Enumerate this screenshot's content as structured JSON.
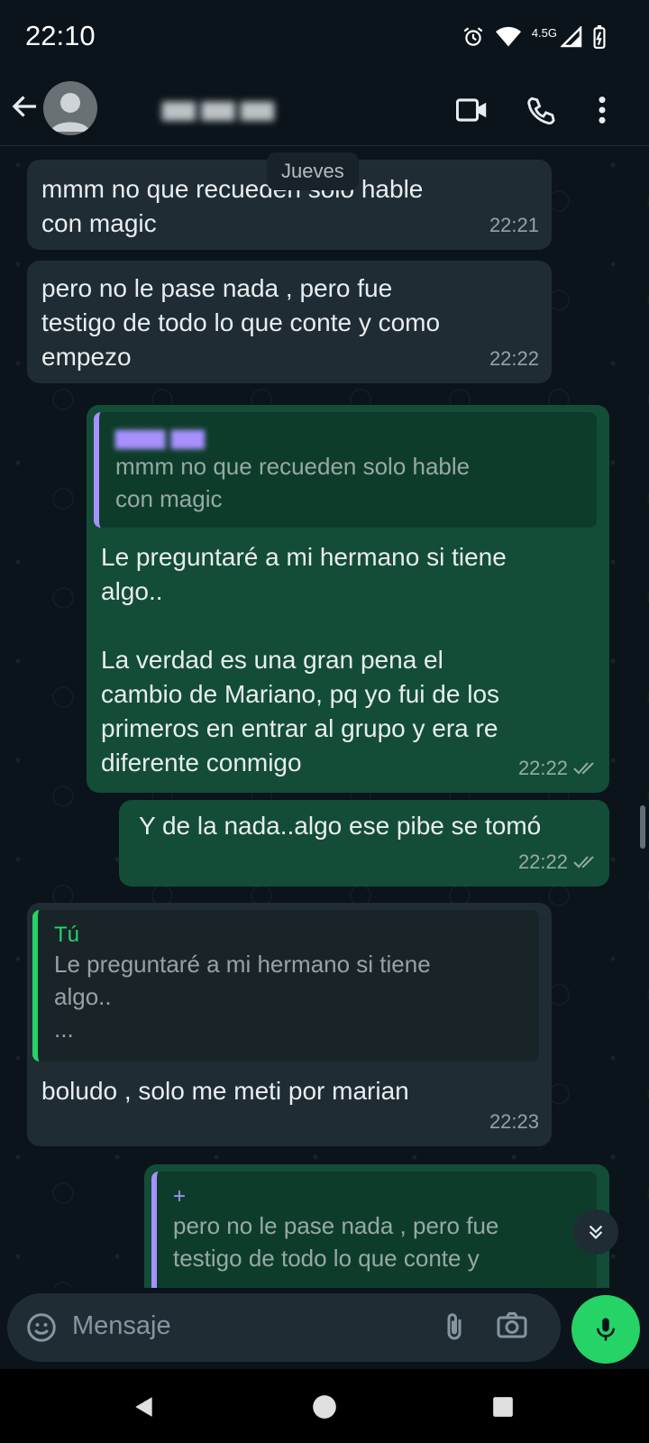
{
  "status": {
    "time": "22:10",
    "network": "4.5G"
  },
  "header": {
    "contact_name": "▆▆ ▆▆ ▆▆"
  },
  "chat": {
    "date_chip": "Jueves",
    "messages": [
      {
        "text": "mmm no que recueden solo hable\ncon magic",
        "time": "22:21"
      },
      {
        "text": "pero no le pase nada , pero fue\ntestigo de todo lo que conte y como\nempezo",
        "time": "22:22"
      },
      {
        "quote_author": "▆▆▆ ▆▆",
        "quote_text": "mmm no que recueden solo hable\ncon magic",
        "text": "Le preguntaré a mi hermano si tiene\nalgo..\n\nLa verdad es una gran pena el\ncambio de Mariano, pq yo fui de los\nprimeros en entrar al grupo y era re\ndiferente conmigo",
        "time": "22:22"
      },
      {
        "text": "Y de la nada..algo ese pibe se tomó",
        "time": "22:22"
      },
      {
        "quote_author": "Tú",
        "quote_text": "Le preguntaré a mi hermano si tiene\nalgo..\n...",
        "text": "boludo , solo me meti por marian",
        "time": "22:23"
      },
      {
        "quote_author": "+",
        "quote_text": "pero no le pase nada , pero fue\ntestigo de todo lo que conte y"
      }
    ]
  },
  "composer": {
    "placeholder": "Mensaje"
  },
  "colors": {
    "accent": "#25d366",
    "outgoing": "#134d37",
    "incoming": "#1f2c33"
  }
}
